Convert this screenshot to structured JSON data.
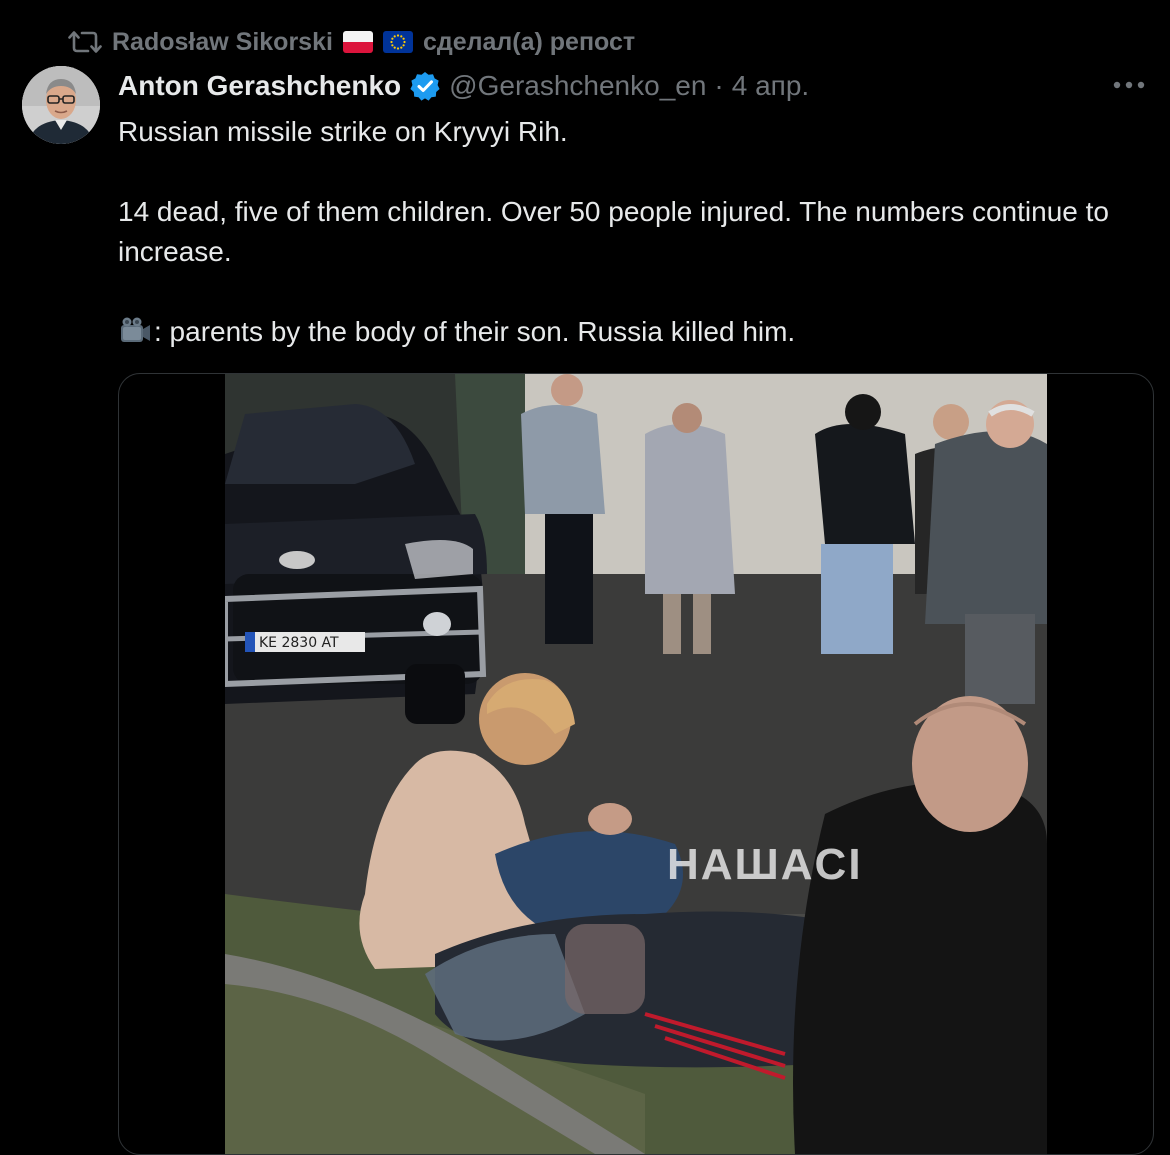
{
  "repost": {
    "reposter_name": "Radosław Sikorski",
    "action_text": "сделал(а) репост",
    "flags": [
      "poland-flag",
      "eu-flag"
    ]
  },
  "author": {
    "display_name": "Anton Gerashchenko",
    "handle": "@Gerashchenko_en",
    "separator": "·",
    "time": "4 апр.",
    "verified": true
  },
  "tweet": {
    "line1": "Russian missile strike on Kryvyi Rih.",
    "line2": "14 dead, five of them children. Over 50 people injured. The numbers continue to increase.",
    "line3": ": parents by the body of their son. Russia killed him."
  },
  "media": {
    "type": "video",
    "watermark": "HAШACI",
    "license_plate": "KE 2830 AT"
  },
  "colors": {
    "background": "#000000",
    "text_primary": "#e7e9ea",
    "text_secondary": "#71767b",
    "verified_blue": "#1d9bf0",
    "border": "#2f3336"
  },
  "icons": {
    "repost": "repost-icon",
    "verified": "verified-badge-icon",
    "more": "more-icon",
    "camera": "video-camera-icon"
  }
}
